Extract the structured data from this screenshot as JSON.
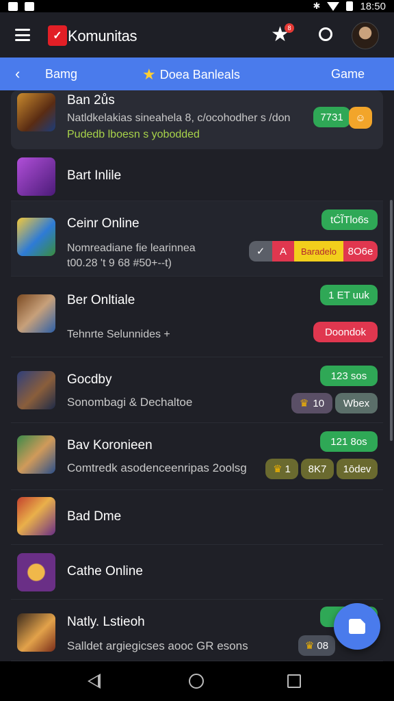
{
  "status_bar": {
    "time": "18:50"
  },
  "app_bar": {
    "title": "Komunitas",
    "logo_icon": "logo-icon",
    "notification_count": "8"
  },
  "tab_bar": {
    "left_label": "Bamg",
    "center_label": "Doea Banleals",
    "right_label": "Game"
  },
  "games": [
    {
      "title": "Ban 2ůs",
      "subtitle": "Natldkelakias sineahela 8, c/ocohodher s /don",
      "subtitle2": "Pudedb lboesn s yobodded",
      "badge": "7731"
    },
    {
      "title": "Bart Inlile"
    },
    {
      "title": "Ceinr Online",
      "subtitle": "Nomreadiane fie learinnea",
      "subtitle2": "t00.28 't 9 68 #50+--t)",
      "badge": "tĆĨTlo6s",
      "seg_check": "✓",
      "seg_a": "A",
      "seg_yellow": "Baradelo",
      "seg_red": "8O6e"
    },
    {
      "title": "Ber Onltiale",
      "subtitle": "Tehnrte Selunnides +",
      "badge": "1 ET uuk",
      "badge2": "Doondok"
    },
    {
      "title": "Gocdby",
      "subtitle": "Sonombagi & Dechaltoe",
      "badge": "123 sos",
      "chip1": "10",
      "chip2": "Wbex"
    },
    {
      "title": "Bav Koronieen",
      "subtitle": "Comtredk asodenceenripas 2oolsg",
      "badge": "121 8os",
      "chip1": "1",
      "chip2": "8K7",
      "chip3": "1ōdev"
    },
    {
      "title": "Bad Dme"
    },
    {
      "title": "Cathe Online"
    },
    {
      "title": "Natly. Lstieoh",
      "subtitle": "Salldet argiegicses aooc GR esons",
      "chip1": "08"
    }
  ],
  "icons": {
    "menu": "hamburger-icon",
    "notification": "star-notification-icon",
    "settings": "settings-icon",
    "back": "back-arrow-icon",
    "star": "star-icon",
    "compose": "compose-icon"
  },
  "colors": {
    "accent": "#4a7bec",
    "green": "#2fa856",
    "red": "#e0374f",
    "yellow": "#ffcf33"
  }
}
